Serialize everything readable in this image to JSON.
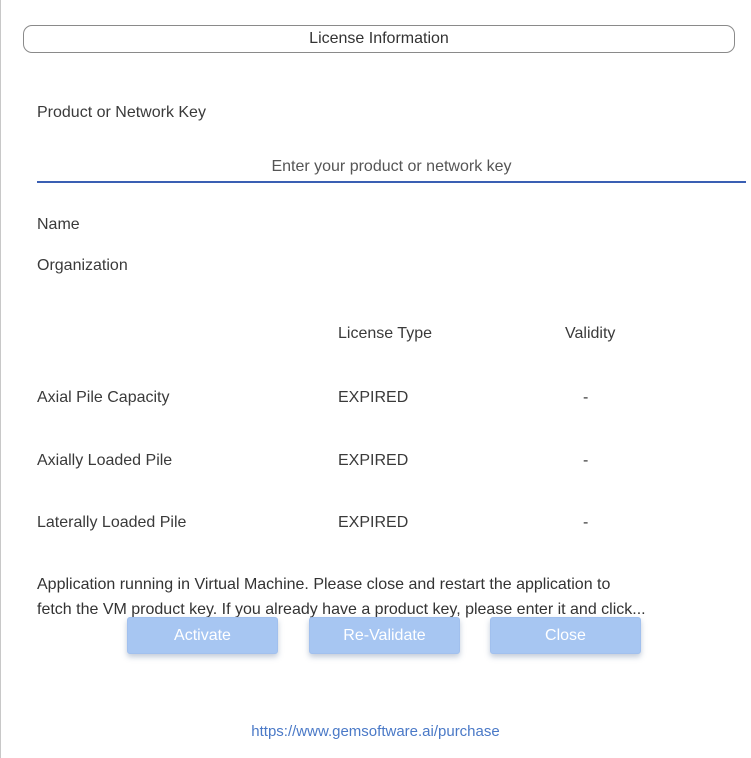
{
  "dialog": {
    "title": "License Information"
  },
  "key_section": {
    "label": "Product or Network Key",
    "input_value": "",
    "input_placeholder": "Enter your product or network key"
  },
  "user_info": {
    "name_label": "Name",
    "organization_label": "Organization"
  },
  "license_table": {
    "headers": {
      "license_type": "License Type",
      "validity": "Validity"
    },
    "rows": [
      {
        "product": "Axial Pile Capacity",
        "license_type": "EXPIRED",
        "validity": "-"
      },
      {
        "product": "Axially Loaded Pile",
        "license_type": "EXPIRED",
        "validity": "-"
      },
      {
        "product": "Laterally Loaded Pile",
        "license_type": "EXPIRED",
        "validity": "-"
      }
    ]
  },
  "notice": {
    "line1": "Application running in Virtual Machine.  Please close and restart the application to",
    "line2": "fetch the VM product key.  If you already have a product key, please enter it and click..."
  },
  "buttons": {
    "activate": "Activate",
    "revalidate": "Re-Validate",
    "close": "Close"
  },
  "purchase_link": "https://www.gemsoftware.ai/purchase",
  "colors": {
    "accent_underline": "#3a5fb3",
    "button_fill": "#a7c6f2",
    "link": "#4a79c7"
  }
}
